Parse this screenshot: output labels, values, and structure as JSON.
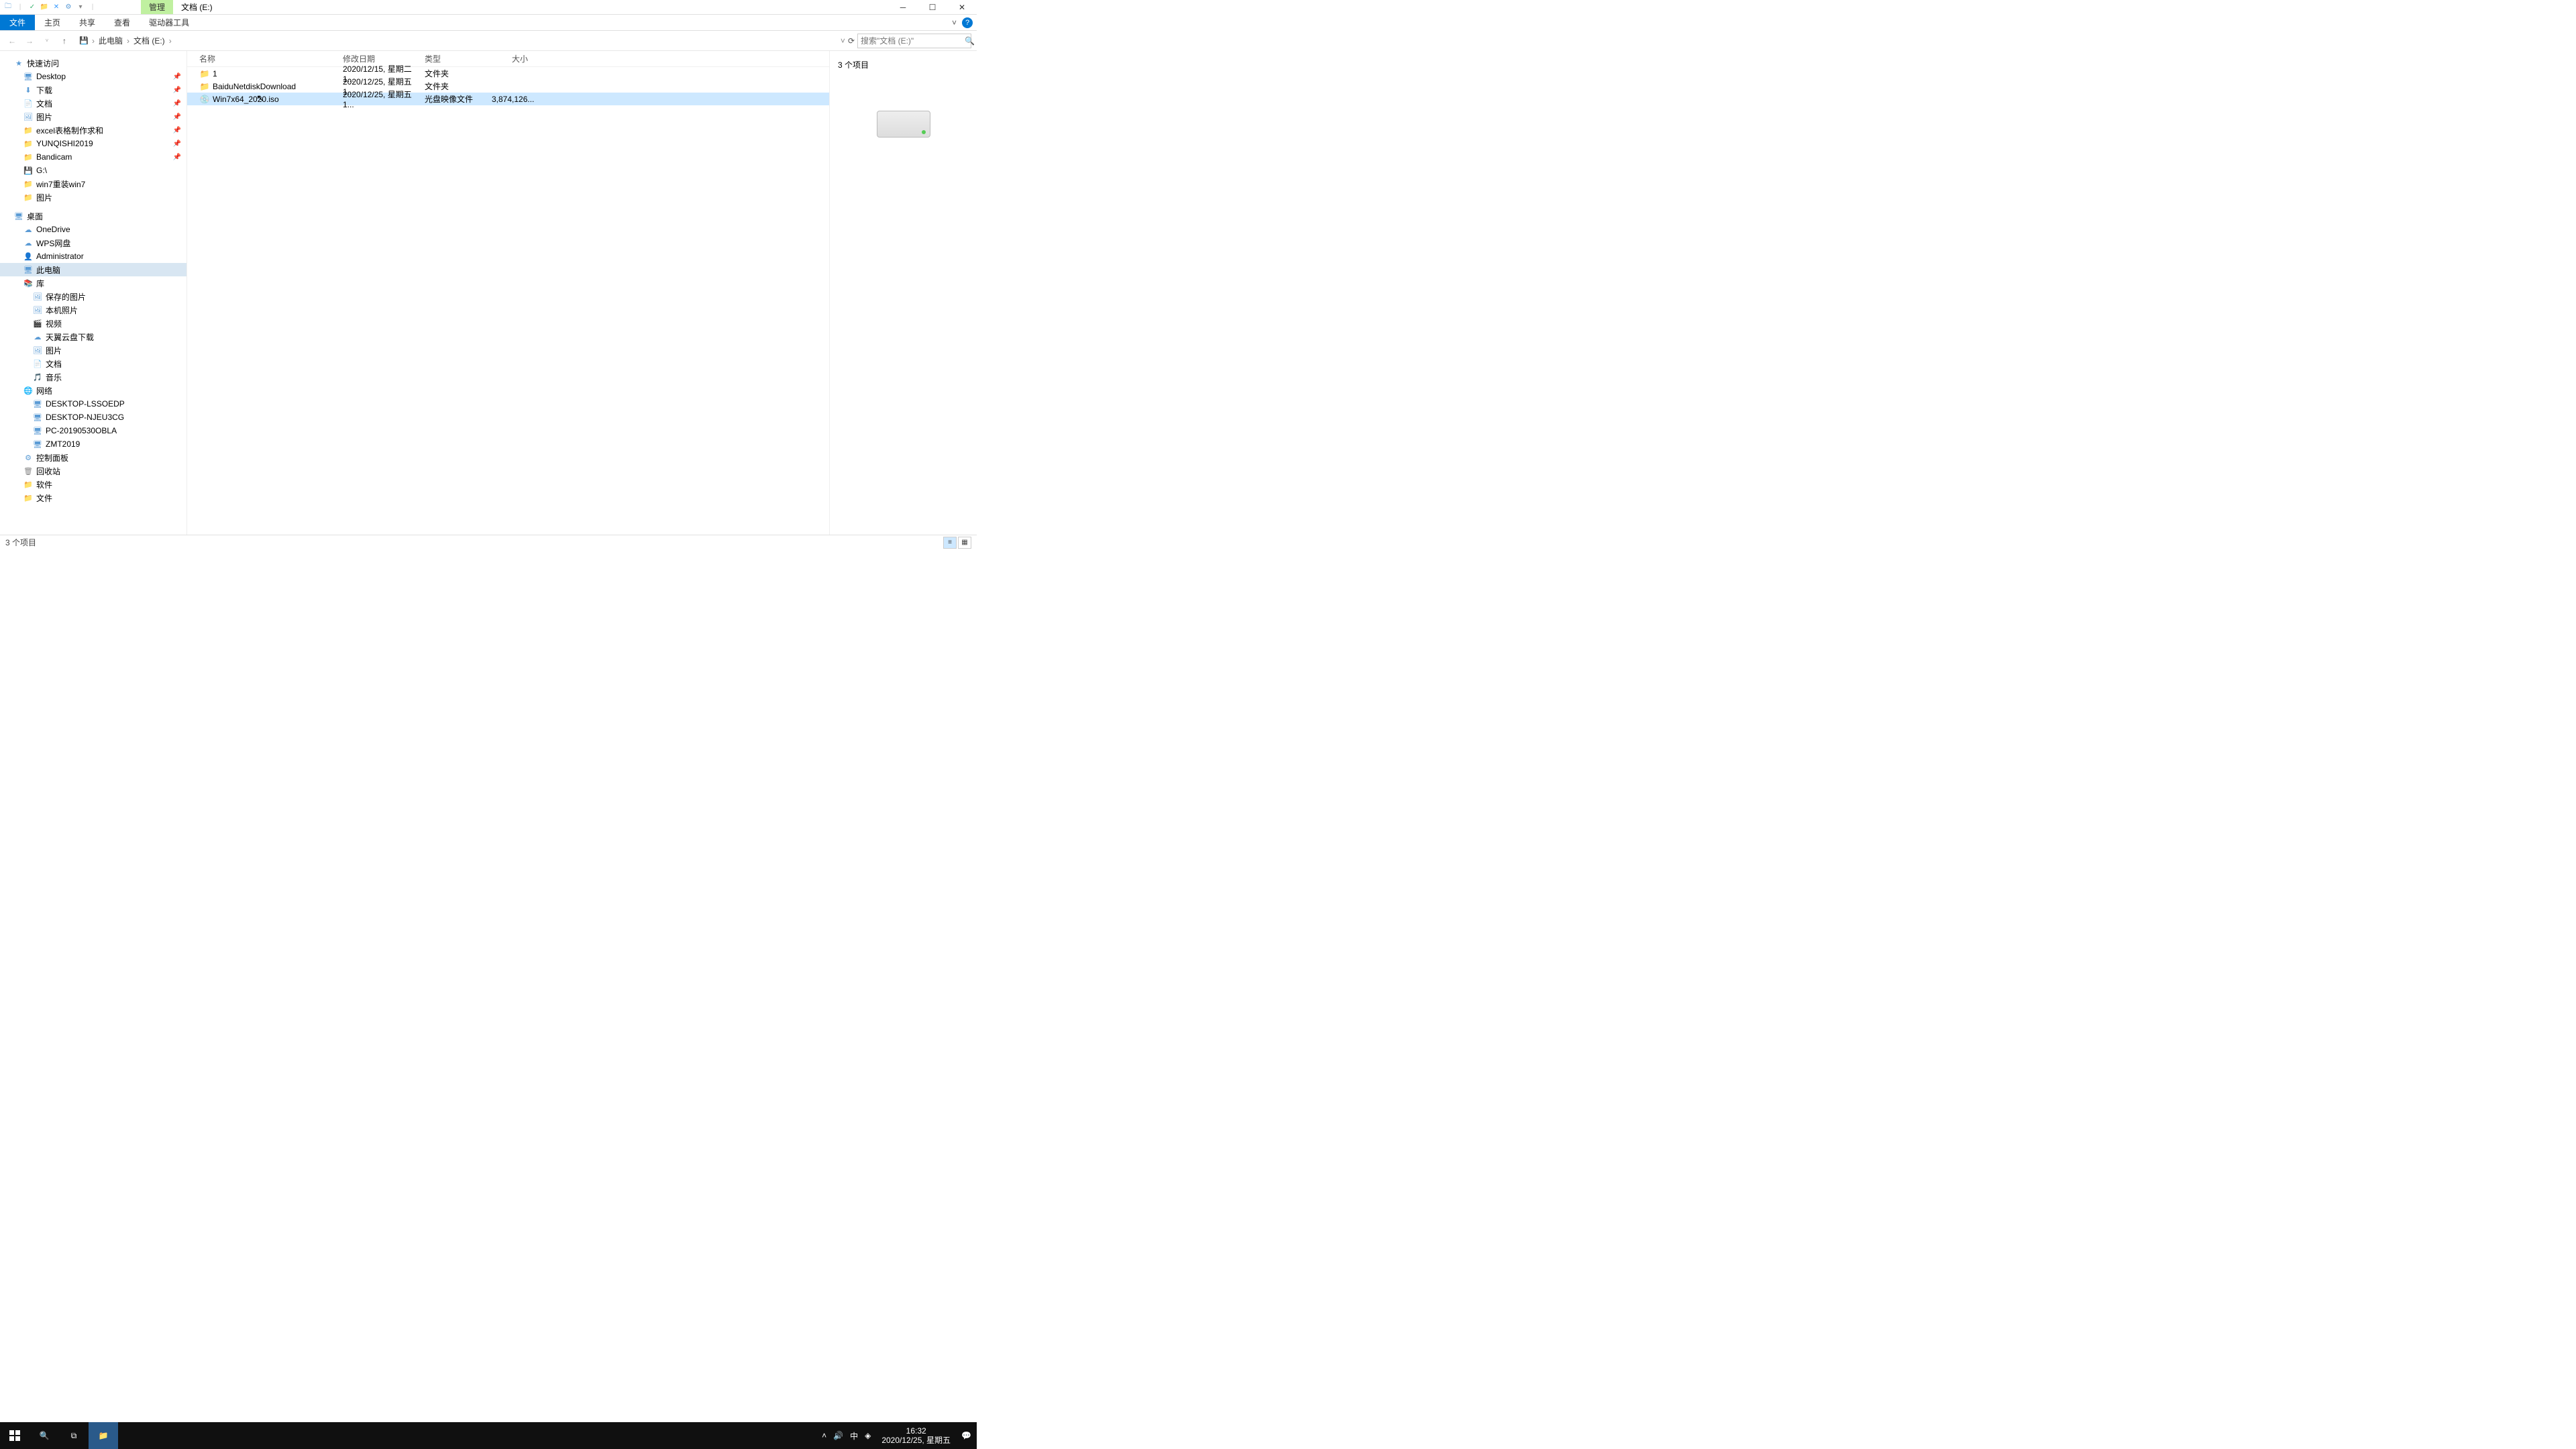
{
  "title": {
    "manage": "管理",
    "drive": "文档 (E:)"
  },
  "ribbon": {
    "file": "文件",
    "home": "主页",
    "share": "共享",
    "view": "查看",
    "drive_tools": "驱动器工具"
  },
  "addr": {
    "pc": "此电脑",
    "drive": "文档 (E:)",
    "search_placeholder": "搜索\"文档 (E:)\""
  },
  "nav": {
    "quick": "快速访问",
    "quick_items": [
      {
        "label": "Desktop",
        "ico": "🖥",
        "col": "ic-blue"
      },
      {
        "label": "下载",
        "ico": "⬇",
        "col": "ic-blue"
      },
      {
        "label": "文档",
        "ico": "📄",
        "col": "ic-folder"
      },
      {
        "label": "图片",
        "ico": "🖼",
        "col": "ic-blue"
      },
      {
        "label": "excel表格制作求和",
        "ico": "📁",
        "col": "ic-folder"
      },
      {
        "label": "YUNQISHI2019",
        "ico": "📁",
        "col": "ic-folder"
      },
      {
        "label": "Bandicam",
        "ico": "📁",
        "col": "ic-folder"
      },
      {
        "label": "G:\\",
        "ico": "💾",
        "col": "ic-blue"
      },
      {
        "label": "win7重装win7",
        "ico": "📁",
        "col": "ic-folder"
      },
      {
        "label": "图片",
        "ico": "📁",
        "col": "ic-folder"
      }
    ],
    "desktop": "桌面",
    "desk_items": [
      {
        "label": "OneDrive",
        "ico": "☁",
        "col": "ic-blue"
      },
      {
        "label": "WPS网盘",
        "ico": "☁",
        "col": "ic-blue"
      },
      {
        "label": "Administrator",
        "ico": "👤",
        "col": "ic-folder"
      },
      {
        "label": "此电脑",
        "ico": "🖥",
        "col": "ic-blue",
        "selected": true
      },
      {
        "label": "库",
        "ico": "📚",
        "col": "ic-folder"
      },
      {
        "label": "保存的图片",
        "ico": "🖼",
        "col": "ic-blue",
        "indent": 1
      },
      {
        "label": "本机照片",
        "ico": "🖼",
        "col": "ic-blue",
        "indent": 1
      },
      {
        "label": "视频",
        "ico": "🎬",
        "col": "ic-blue",
        "indent": 1
      },
      {
        "label": "天翼云盘下载",
        "ico": "☁",
        "col": "ic-blue",
        "indent": 1
      },
      {
        "label": "图片",
        "ico": "🖼",
        "col": "ic-blue",
        "indent": 1
      },
      {
        "label": "文档",
        "ico": "📄",
        "col": "ic-folder",
        "indent": 1
      },
      {
        "label": "音乐",
        "ico": "🎵",
        "col": "ic-blue",
        "indent": 1
      },
      {
        "label": "网络",
        "ico": "🌐",
        "col": "ic-net"
      },
      {
        "label": "DESKTOP-LSSOEDP",
        "ico": "🖥",
        "col": "ic-blue",
        "indent": 1
      },
      {
        "label": "DESKTOP-NJEU3CG",
        "ico": "🖥",
        "col": "ic-blue",
        "indent": 1
      },
      {
        "label": "PC-20190530OBLA",
        "ico": "🖥",
        "col": "ic-blue",
        "indent": 1
      },
      {
        "label": "ZMT2019",
        "ico": "🖥",
        "col": "ic-blue",
        "indent": 1
      },
      {
        "label": "控制面板",
        "ico": "⚙",
        "col": "ic-blue"
      },
      {
        "label": "回收站",
        "ico": "🗑",
        "col": "ic-disk"
      },
      {
        "label": "软件",
        "ico": "📁",
        "col": "ic-folder"
      },
      {
        "label": "文件",
        "ico": "📁",
        "col": "ic-folder"
      }
    ]
  },
  "cols": {
    "name": "名称",
    "date": "修改日期",
    "type": "类型",
    "size": "大小"
  },
  "rows": [
    {
      "name": "1",
      "date": "2020/12/15, 星期二 1...",
      "type": "文件夹",
      "size": "",
      "ico": "📁",
      "col": "ic-folder"
    },
    {
      "name": "BaiduNetdiskDownload",
      "date": "2020/12/25, 星期五 1...",
      "type": "文件夹",
      "size": "",
      "ico": "📁",
      "col": "ic-folder"
    },
    {
      "name": "Win7x64_2020.iso",
      "date": "2020/12/25, 星期五 1...",
      "type": "光盘映像文件",
      "size": "3,874,126...",
      "ico": "💿",
      "col": "ic-disk",
      "selected": true
    }
  ],
  "preview": {
    "count": "3 个项目"
  },
  "status": {
    "text": "3 个项目"
  },
  "clock": {
    "time": "16:32",
    "date": "2020/12/25, 星期五"
  }
}
